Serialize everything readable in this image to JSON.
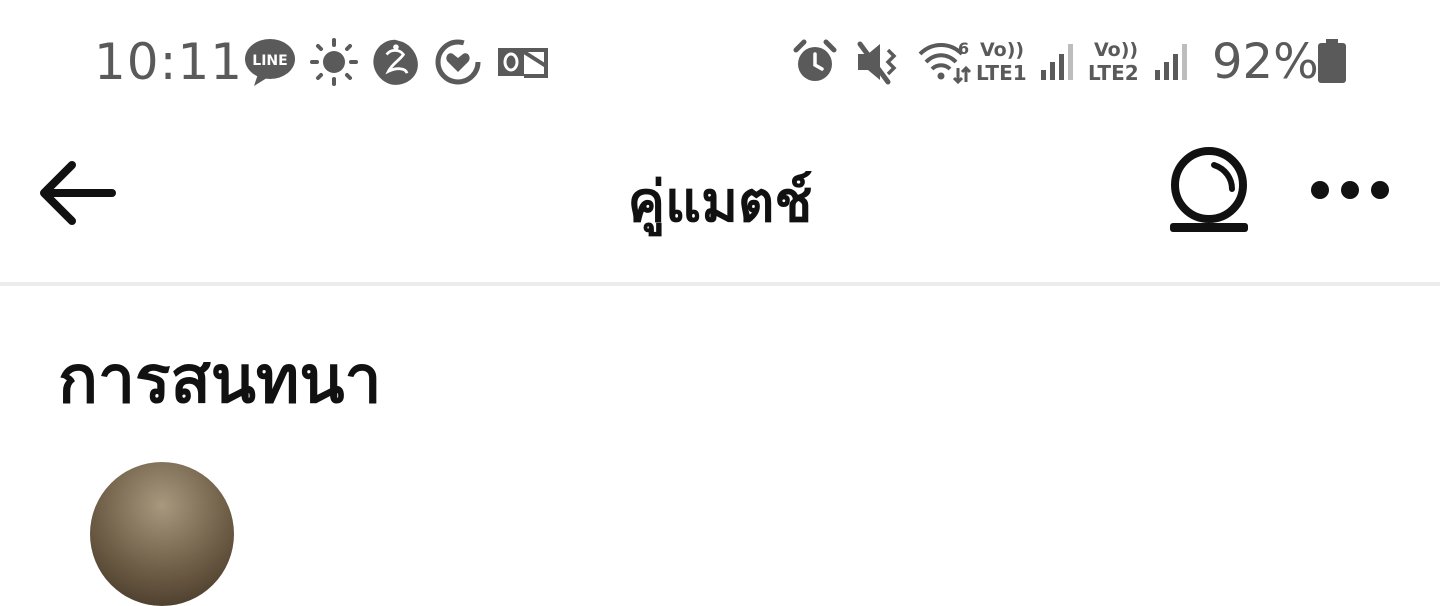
{
  "status_bar": {
    "time": "10:11",
    "left_icons": [
      "line-app-icon",
      "brightness-icon",
      "kasikorn-bank-icon",
      "heart-sync-icon",
      "outlook-icon"
    ],
    "right_icons": [
      "alarm-icon",
      "muted-icon",
      "wifi-6-icon",
      "volte-lte1-icon",
      "signal-icon",
      "volte-lte2-icon",
      "signal-icon",
      "battery-icon"
    ],
    "line_label": "LINE",
    "wifi_label": "6",
    "volte1_top": "Vo))",
    "volte1_bottom": "LTE1",
    "volte2_top": "Vo))",
    "volte2_bottom": "LTE2",
    "battery_percent": "92%"
  },
  "app_bar": {
    "title": "คู่แมตช์"
  },
  "section": {
    "title": "การสนทนา"
  }
}
